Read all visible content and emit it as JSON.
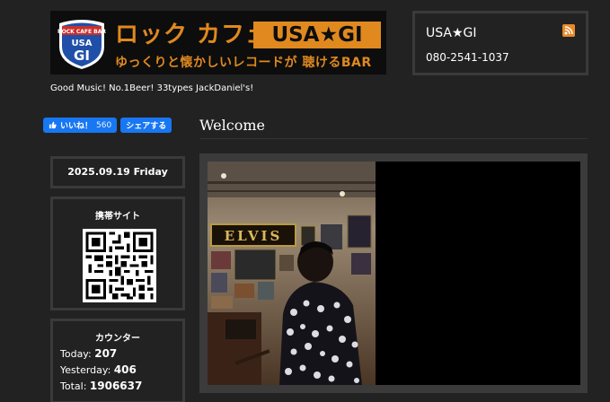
{
  "header": {
    "shield_top": "ROCK CAFE BAR",
    "shield_usa": "USA",
    "shield_gi": "GI",
    "title": "ロック カフェ",
    "brand": "USA★GI",
    "subtitle": "ゆっくりと懐かしいレコードが 聴けるBAR"
  },
  "contact": {
    "name": "USA★GI",
    "phone": "080-2541-1037"
  },
  "tagline": "Good Music! No.1Beer! 33types JackDaniel's!",
  "facebook": {
    "like_label": "いいね！",
    "like_count": "560",
    "share_label": "シェアする"
  },
  "main": {
    "heading": "Welcome"
  },
  "sidebar": {
    "date": "2025.09.19 Friday",
    "mobile_title": "携帯サイト",
    "counter_title": "カウンター",
    "counter": {
      "today_label": "Today:",
      "today": "207",
      "yesterday_label": "Yesterday:",
      "yesterday": "406",
      "total_label": "Total:",
      "total": "1906637"
    }
  },
  "photo": {
    "sign": "ELVIS"
  },
  "colors": {
    "background": "#222222",
    "accent": "#e0891f",
    "facebook": "#1877f2",
    "border": "#3a3a3a"
  }
}
